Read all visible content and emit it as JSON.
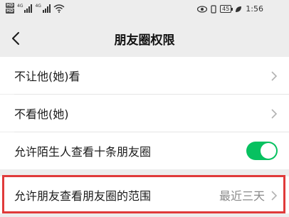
{
  "status_bar": {
    "sim1": "HD",
    "sim2": "HD",
    "network1": "4G",
    "network2": "4G",
    "battery": "45",
    "time": "1:56"
  },
  "header": {
    "title": "朋友圈权限"
  },
  "rows": [
    {
      "label": "不让他(她)看"
    },
    {
      "label": "不看他(她)"
    },
    {
      "label": "允许陌生人查看十条朋友圈",
      "toggle_on": true
    },
    {
      "label": "允许朋友查看朋友圈的范围",
      "value": "最近三天"
    }
  ],
  "colors": {
    "toggle_on": "#07c160",
    "highlight": "#e03a3a"
  }
}
